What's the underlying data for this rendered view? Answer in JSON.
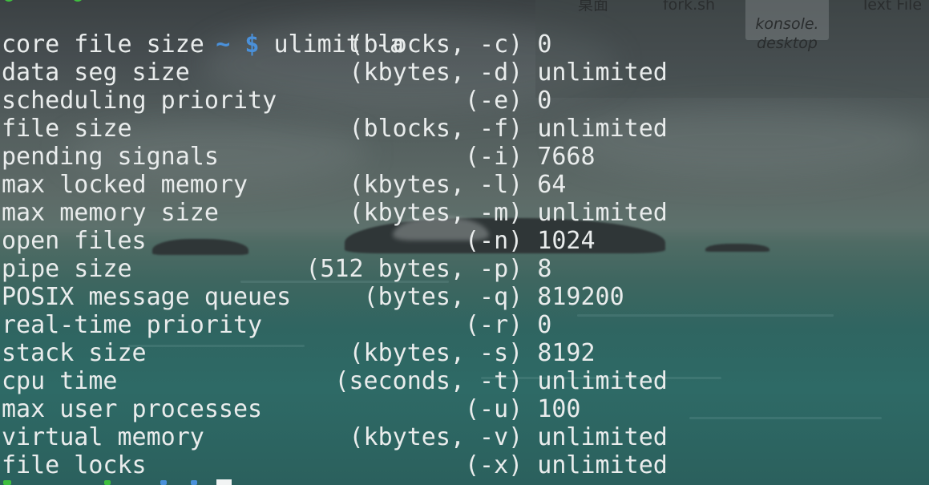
{
  "desktop": {
    "icons": [
      {
        "label": "桌面",
        "icon": "folder-icon"
      },
      {
        "label": "fork.sh",
        "icon": "script-file-icon"
      },
      {
        "label": "konsole.\ndesktop",
        "icon": "desktop-file-icon",
        "selected": true
      },
      {
        "label": "Text File",
        "icon": "text-file-icon"
      }
    ]
  },
  "terminal": {
    "prompt": {
      "tilde": "~",
      "dollar": "$",
      "command": "ulimit -a"
    },
    "rows": [
      {
        "name": "core file size",
        "unit": "(blocks, -c)",
        "value": "0"
      },
      {
        "name": "data seg size",
        "unit": "(kbytes, -d)",
        "value": "unlimited"
      },
      {
        "name": "scheduling priority",
        "unit": "(-e)",
        "value": "0"
      },
      {
        "name": "file size",
        "unit": "(blocks, -f)",
        "value": "unlimited"
      },
      {
        "name": "pending signals",
        "unit": "(-i)",
        "value": "7668"
      },
      {
        "name": "max locked memory",
        "unit": "(kbytes, -l)",
        "value": "64"
      },
      {
        "name": "max memory size",
        "unit": "(kbytes, -m)",
        "value": "unlimited"
      },
      {
        "name": "open files",
        "unit": "(-n)",
        "value": "1024"
      },
      {
        "name": "pipe size",
        "unit": "(512 bytes, -p)",
        "value": "8"
      },
      {
        "name": "POSIX message queues",
        "unit": "(bytes, -q)",
        "value": "819200"
      },
      {
        "name": "real-time priority",
        "unit": "(-r)",
        "value": "0"
      },
      {
        "name": "stack size",
        "unit": "(kbytes, -s)",
        "value": "8192"
      },
      {
        "name": "cpu time",
        "unit": "(seconds, -t)",
        "value": "unlimited"
      },
      {
        "name": "max user processes",
        "unit": "(-u)",
        "value": "100"
      },
      {
        "name": "virtual memory",
        "unit": "(kbytes, -v)",
        "value": "unlimited"
      },
      {
        "name": "file locks",
        "unit": "(-x)",
        "value": "unlimited"
      }
    ],
    "colors": {
      "text": "#e9ecec",
      "prompt_accent": "#4a90d9",
      "user_host_green": "#3fbf3f",
      "cursor": "#f2f4f4"
    }
  }
}
